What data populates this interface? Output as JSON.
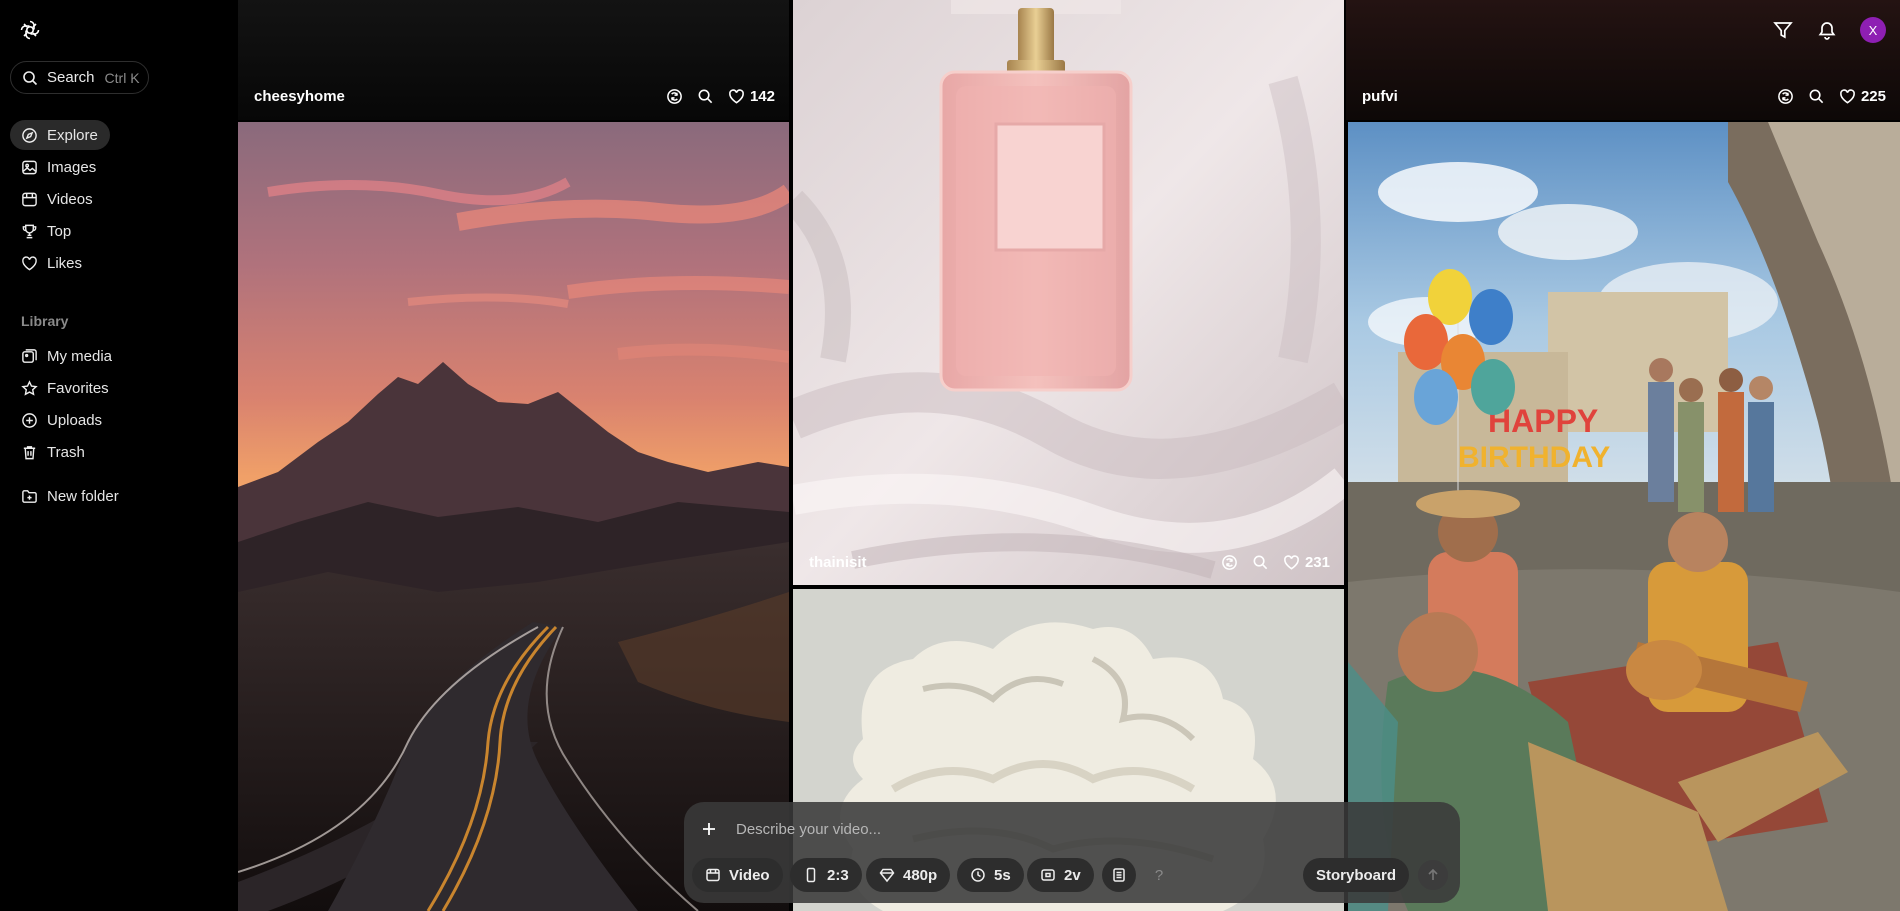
{
  "sidebar": {
    "search": {
      "label": "Search",
      "shortcut": "Ctrl K"
    },
    "nav": [
      {
        "label": "Explore",
        "icon": "compass-icon",
        "active": true
      },
      {
        "label": "Images",
        "icon": "image-icon"
      },
      {
        "label": "Videos",
        "icon": "video-icon"
      },
      {
        "label": "Top",
        "icon": "trophy-icon"
      },
      {
        "label": "Likes",
        "icon": "heart-icon"
      }
    ],
    "library_label": "Library",
    "library": [
      {
        "label": "My media",
        "icon": "media-icon"
      },
      {
        "label": "Favorites",
        "icon": "star-icon"
      },
      {
        "label": "Uploads",
        "icon": "upload-icon"
      },
      {
        "label": "Trash",
        "icon": "trash-icon"
      }
    ],
    "new_folder": {
      "label": "New folder",
      "icon": "folder-plus-icon"
    }
  },
  "feed": {
    "tiles": [
      {
        "user": "cheesyhome",
        "likes": "142"
      },
      {
        "user": "thainisit",
        "likes": "231"
      },
      {
        "user": "pufvi",
        "likes": "225"
      }
    ]
  },
  "user": {
    "avatar_initial": "X",
    "avatar_color": "#8e1fb3"
  },
  "prompt": {
    "placeholder": "Describe your video...",
    "mode": "Video",
    "aspect": "2:3",
    "resolution": "480p",
    "duration": "5s",
    "variants": "2v",
    "help": "?",
    "storyboard": "Storyboard"
  }
}
